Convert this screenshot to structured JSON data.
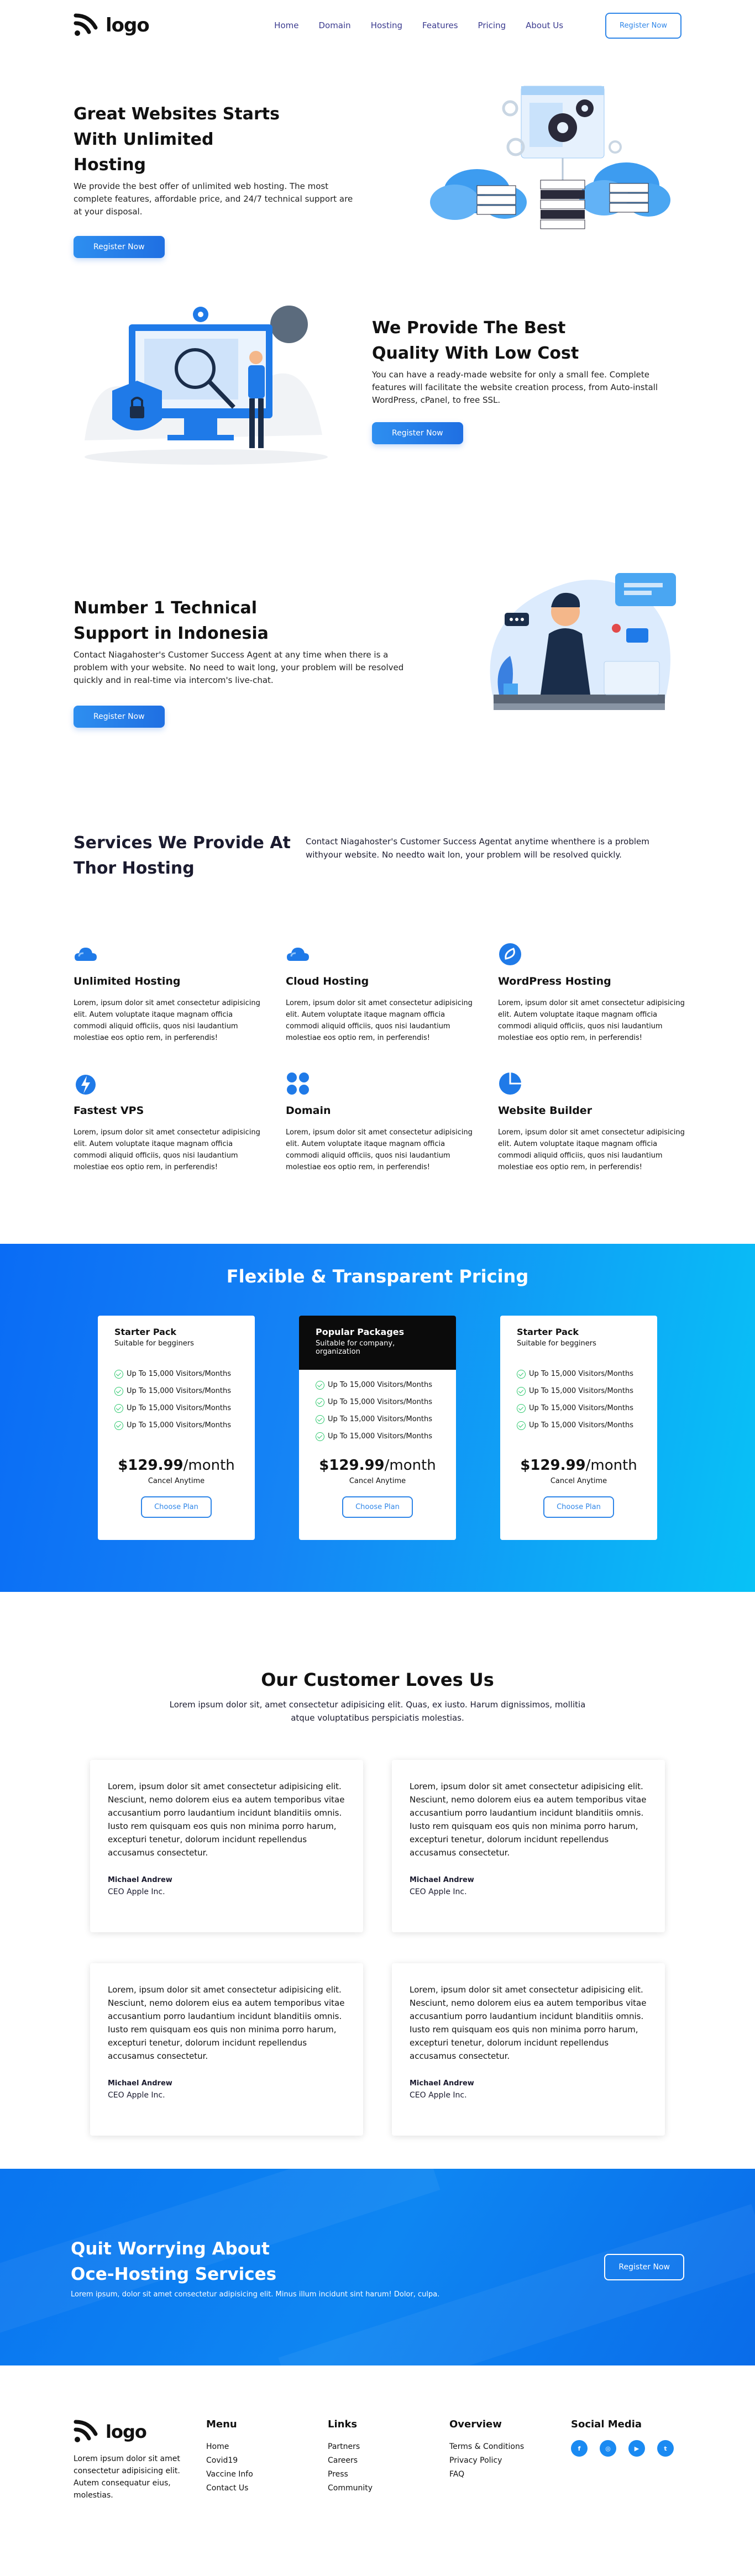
{
  "nav": {
    "logo_text": "logo",
    "links": [
      "Home",
      "Domain",
      "Hosting",
      "Features",
      "Pricing",
      "About Us"
    ],
    "register_label": "Register Now"
  },
  "hero": {
    "title_line1": "Great Websites Starts",
    "title_line2": "With Unlimited",
    "title_line3": "Hosting",
    "text": "We provide the best offer of unlimited web hosting. The most complete features, affordable price, and 24/7 technical support are at your disposal.",
    "button": "Register Now"
  },
  "best": {
    "title_line1": "We Provide The Best",
    "title_line2": "Quality With Low Cost",
    "text": "You can have a ready-made website for only a small fee. Complete features will facilitate the website creation process, from Auto-install WordPress, cPanel, to free SSL.",
    "button": "Register Now"
  },
  "support": {
    "title_line1": "Number 1 Technical",
    "title_line2": "Support in Indonesia",
    "text": "Contact Niagahoster's Customer Success Agent at any time when there is a problem with your website. No need to wait long, your problem will be resolved quickly and in real-time via intercom's live-chat.",
    "button": "Register Now"
  },
  "services": {
    "title_line1": "Services We Provide At",
    "title_line2": "Thor Hosting",
    "desc": "Contact Niagahoster's Customer Success Agentat anytime whenthere is a problem withyour website. No needto wait lon, your problem will be resolved quickly.",
    "items": [
      {
        "title": "Unlimited Hosting",
        "text": "Lorem, ipsum dolor sit amet consectetur adipisicing elit. Autem voluptate itaque magnam officia commodi aliquid officiis, quos nisi laudantium molestiae eos optio rem, in perferendis!"
      },
      {
        "title": "Cloud Hosting",
        "text": "Lorem, ipsum dolor sit amet consectetur adipisicing elit. Autem voluptate itaque magnam officia commodi aliquid officiis, quos nisi laudantium molestiae eos optio rem, in perferendis!"
      },
      {
        "title": "WordPress Hosting",
        "text": "Lorem, ipsum dolor sit amet consectetur adipisicing elit. Autem voluptate itaque magnam officia commodi aliquid officiis, quos nisi laudantium molestiae eos optio rem, in perferendis!"
      },
      {
        "title": "Fastest VPS",
        "text": "Lorem, ipsum dolor sit amet consectetur adipisicing elit. Autem voluptate itaque magnam officia commodi aliquid officiis, quos nisi laudantium molestiae eos optio rem, in perferendis!"
      },
      {
        "title": "Domain",
        "text": "Lorem, ipsum dolor sit amet consectetur adipisicing elit. Autem voluptate itaque magnam officia commodi aliquid officiis, quos nisi laudantium molestiae eos optio rem, in perferendis!"
      },
      {
        "title": "Website Builder",
        "text": "Lorem, ipsum dolor sit amet consectetur adipisicing elit. Autem voluptate itaque magnam officia commodi aliquid officiis, quos nisi laudantium molestiae eos optio rem, in perferendis!"
      }
    ]
  },
  "pricing": {
    "title": "Flexible & Transparent Pricing",
    "plans": [
      {
        "name": "Starter Pack",
        "sub": "Suitable for begginers",
        "features": [
          "Up To 15,000 Visitors/Months",
          "Up To 15,000 Visitors/Months",
          "Up To 15,000 Visitors/Months",
          "Up To 15,000 Visitors/Months"
        ],
        "price": "$129.99",
        "per": "/month",
        "cancel": "Cancel Anytime",
        "button": "Choose Plan"
      },
      {
        "name": "Popular Packages",
        "sub": "Suitable for company, organization",
        "features": [
          "Up To 15,000 Visitors/Months",
          "Up To 15,000 Visitors/Months",
          "Up To 15,000 Visitors/Months",
          "Up To 15,000 Visitors/Months"
        ],
        "price": "$129.99",
        "per": "/month",
        "cancel": "Cancel Anytime",
        "button": "Choose Plan"
      },
      {
        "name": "Starter Pack",
        "sub": "Suitable for begginers",
        "features": [
          "Up To 15,000 Visitors/Months",
          "Up To 15,000 Visitors/Months",
          "Up To 15,000 Visitors/Months",
          "Up To 15,000 Visitors/Months"
        ],
        "price": "$129.99",
        "per": "/month",
        "cancel": "Cancel Anytime",
        "button": "Choose Plan"
      }
    ]
  },
  "testimonials": {
    "title": "Our Customer Loves Us",
    "desc": "Lorem ipsum dolor sit, amet consectetur adipisicing elit. Quas, ex iusto. Harum dignissimos, mollitia atque voluptatibus perspiciatis molestias.",
    "items": [
      {
        "text": "Lorem, ipsum dolor sit amet consectetur adipisicing elit. Nesciunt, nemo dolorem eius ea autem temporibus vitae accusantium porro laudantium incidunt blanditiis omnis. Iusto rem quisquam eos quis non minima porro harum, excepturi tenetur, dolorum incidunt repellendus accusamus consectetur.",
        "name": "Michael Andrew",
        "role": "CEO Apple Inc."
      },
      {
        "text": "Lorem, ipsum dolor sit amet consectetur adipisicing elit. Nesciunt, nemo dolorem eius ea autem temporibus vitae accusantium porro laudantium incidunt blanditiis omnis. Iusto rem quisquam eos quis non minima porro harum, excepturi tenetur, dolorum incidunt repellendus accusamus consectetur.",
        "name": "Michael Andrew",
        "role": "CEO Apple Inc."
      },
      {
        "text": "Lorem, ipsum dolor sit amet consectetur adipisicing elit. Nesciunt, nemo dolorem eius ea autem temporibus vitae accusantium porro laudantium incidunt blanditiis omnis. Iusto rem quisquam eos quis non minima porro harum, excepturi tenetur, dolorum incidunt repellendus accusamus consectetur.",
        "name": "Michael Andrew",
        "role": "CEO Apple Inc."
      },
      {
        "text": "Lorem, ipsum dolor sit amet consectetur adipisicing elit. Nesciunt, nemo dolorem eius ea autem temporibus vitae accusantium porro laudantium incidunt blanditiis omnis. Iusto rem quisquam eos quis non minima porro harum, excepturi tenetur, dolorum incidunt repellendus accusamus consectetur.",
        "name": "Michael Andrew",
        "role": "CEO Apple Inc."
      }
    ]
  },
  "cta": {
    "title_line1": "Quit Worrying About",
    "title_line2": "Oce-Hosting Services",
    "sub": "Lorem ipsum, dolor sit amet consectetur adipisicing elit. Minus illum incidunt sint harum! Dolor, culpa.",
    "button": "Register Now"
  },
  "footer": {
    "logo_text": "logo",
    "about": "Lorem ipsum dolor sit amet consectetur adipisicing elit. Autem consequatur eius, molestias.",
    "menu": {
      "title": "Menu",
      "links": [
        "Home",
        "Covid19",
        "Vaccine Info",
        "Contact Us"
      ]
    },
    "links": {
      "title": "Links",
      "links": [
        "Partners",
        "Careers",
        "Press",
        "Community"
      ]
    },
    "overview": {
      "title": "Overview",
      "links": [
        "Terms & Conditions",
        "Privacy Policy",
        "FAQ"
      ]
    },
    "social": {
      "title": "Social Media",
      "icons": [
        "fb",
        "ig",
        "yt",
        "tw"
      ]
    }
  },
  "colors": {
    "primary": "#1f7ae8",
    "accent": "#08c2f6",
    "dark": "#0b0b0b",
    "check": "#2ec86e"
  }
}
